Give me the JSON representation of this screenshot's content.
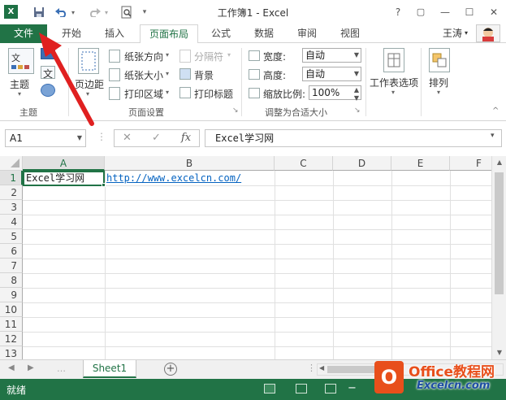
{
  "window": {
    "title": "工作簿1 - Excel"
  },
  "title_bar": {
    "help": "?",
    "restore": "▢",
    "minimize": "—",
    "maximize": "☐",
    "close": "✕"
  },
  "tabs": {
    "file": "文件",
    "items": [
      "开始",
      "插入",
      "页面布局",
      "公式",
      "数据",
      "审阅",
      "视图"
    ],
    "active": "页面布局",
    "user": "王涛"
  },
  "ribbon": {
    "themes": {
      "button": "主题",
      "group": "主题",
      "sample": "文"
    },
    "page_setup": {
      "margins": "页边距",
      "orientation": "纸张方向",
      "size": "纸张大小",
      "print_area": "打印区域",
      "breaks": "分隔符",
      "background": "背景",
      "print_titles": "打印标题",
      "group": "页面设置"
    },
    "scale_to_fit": {
      "width_label": "宽度:",
      "width_value": "自动",
      "height_label": "高度:",
      "height_value": "自动",
      "scale_label": "缩放比例:",
      "scale_value": "100%",
      "group": "调整为合适大小"
    },
    "sheet_options": {
      "button": "工作表选项"
    },
    "arrange": {
      "button": "排列"
    }
  },
  "formula_bar": {
    "name_box": "A1",
    "cancel": "✕",
    "enter": "✓",
    "fx": "fx",
    "content": "Excel学习网"
  },
  "grid": {
    "columns": [
      "A",
      "B",
      "C",
      "D",
      "E",
      "F"
    ],
    "rows": [
      "1",
      "2",
      "3",
      "4",
      "5",
      "6",
      "7",
      "8",
      "9",
      "10",
      "11",
      "12",
      "13"
    ],
    "selected_cell": "A1",
    "cells": {
      "A1": "Excel学习网",
      "B1": "http://www.excelcn.com/"
    }
  },
  "sheets": {
    "tabs": [
      "Sheet1"
    ],
    "active": "Sheet1",
    "add": "+"
  },
  "status_bar": {
    "ready": "就绪"
  },
  "watermark": {
    "line1": "Office教程网",
    "line2": "Excelcn.com"
  },
  "colors": {
    "accent": "#217346",
    "hyperlink": "#0563c1",
    "annotation": "#e02020"
  }
}
